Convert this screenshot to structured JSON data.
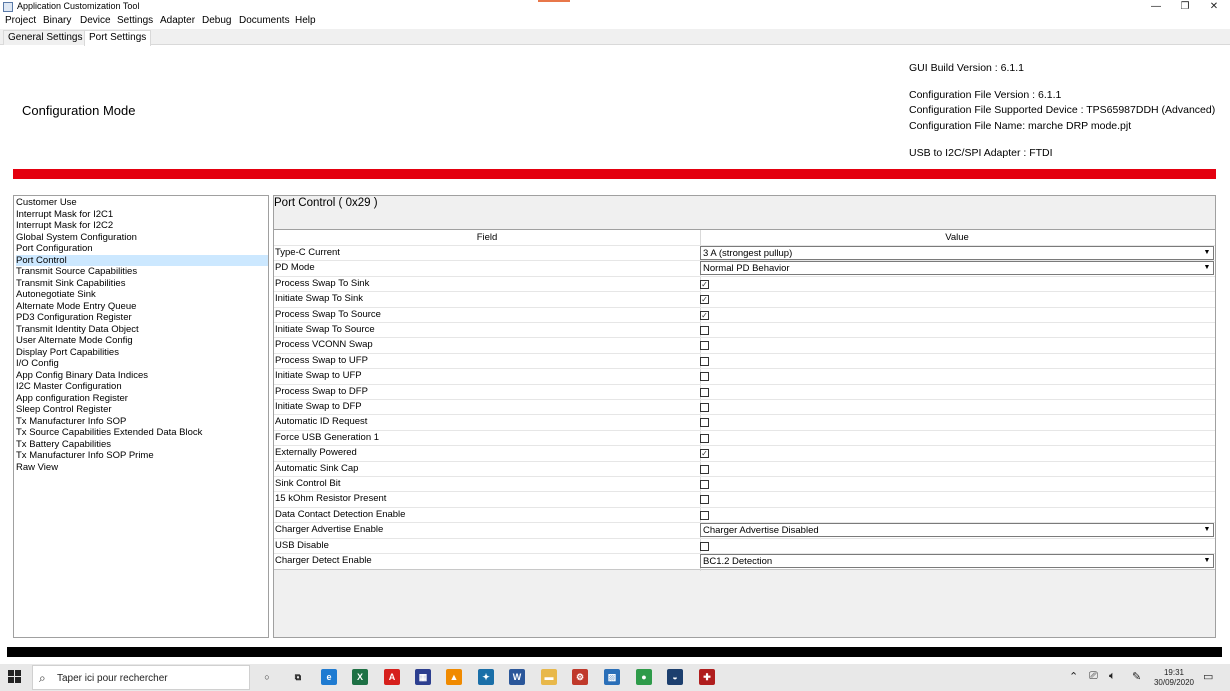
{
  "window": {
    "title": "Application Customization Tool",
    "minimize": "—",
    "restore": "❐",
    "close": "✕"
  },
  "menu": [
    "Project",
    "Binary",
    "Device",
    "Settings",
    "Adapter",
    "Debug",
    "Documents",
    "Help"
  ],
  "tabs": [
    "General Settings",
    "Port Settings"
  ],
  "header": {
    "mode": "Configuration Mode",
    "gui_build": "GUI Build Version : 6.1.1",
    "config_version": "Configuration File Version : 6.1.1",
    "supported_device": "Configuration File Supported Device : TPS65987DDH (Advanced)",
    "file_name": "Configuration File Name: marche DRP mode.pjt",
    "adapter": "USB to I2C/SPI Adapter : FTDI"
  },
  "colors": {
    "red_bar": "#e4000f",
    "selection": "#cce8ff"
  },
  "register_list": [
    "Customer Use",
    "Interrupt Mask for I2C1",
    "Interrupt Mask for I2C2",
    "Global System Configuration",
    "Port Configuration",
    "Port Control",
    "Transmit Source Capabilities",
    "Transmit Sink Capabilities",
    "Autonegotiate Sink",
    "Alternate Mode Entry Queue",
    "PD3 Configuration Register",
    "Transmit Identity Data Object",
    "User Alternate Mode Config",
    "Display Port Capabilities",
    "I/O Config",
    "App Config Binary Data Indices",
    "I2C Master Configuration",
    "App configuration Register",
    "Sleep Control Register",
    "Tx Manufacturer Info SOP",
    "Tx Source Capabilities Extended Data Block",
    "Tx Battery Capabilities",
    "Tx Manufacturer Info SOP Prime",
    "Raw View"
  ],
  "selected_register": "Port Control",
  "panel": {
    "title": "Port Control  ( 0x29 )",
    "col_field": "Field",
    "col_value": "Value",
    "rows": [
      {
        "field": "Type-C Current",
        "type": "dropdown",
        "value": "3 A (strongest pullup)"
      },
      {
        "field": "PD Mode",
        "type": "dropdown",
        "value": "Normal PD Behavior"
      },
      {
        "field": "Process Swap To Sink",
        "type": "checkbox",
        "checked": true
      },
      {
        "field": "Initiate Swap To Sink",
        "type": "checkbox",
        "checked": true
      },
      {
        "field": "Process Swap To Source",
        "type": "checkbox",
        "checked": true
      },
      {
        "field": "Initiate Swap To Source",
        "type": "checkbox",
        "checked": false
      },
      {
        "field": "Process VCONN Swap",
        "type": "checkbox",
        "checked": false
      },
      {
        "field": "Process Swap to UFP",
        "type": "checkbox",
        "checked": false
      },
      {
        "field": "Initiate Swap to UFP",
        "type": "checkbox",
        "checked": false
      },
      {
        "field": "Process Swap to DFP",
        "type": "checkbox",
        "checked": false
      },
      {
        "field": "Initiate Swap to DFP",
        "type": "checkbox",
        "checked": false
      },
      {
        "field": "Automatic ID Request",
        "type": "checkbox",
        "checked": false
      },
      {
        "field": "Force USB Generation 1",
        "type": "checkbox",
        "checked": false
      },
      {
        "field": "Externally Powered",
        "type": "checkbox",
        "checked": true
      },
      {
        "field": "Automatic Sink Cap",
        "type": "checkbox",
        "checked": false
      },
      {
        "field": "Sink Control Bit",
        "type": "checkbox",
        "checked": false
      },
      {
        "field": "15 kOhm Resistor Present",
        "type": "checkbox",
        "checked": false
      },
      {
        "field": "Data Contact Detection Enable",
        "type": "checkbox",
        "checked": false
      },
      {
        "field": "Charger Advertise Enable",
        "type": "dropdown",
        "value": "Charger Advertise Disabled"
      },
      {
        "field": "USB Disable",
        "type": "checkbox",
        "checked": false
      },
      {
        "field": "Charger Detect Enable",
        "type": "dropdown",
        "value": "BC1.2 Detection"
      }
    ]
  },
  "taskbar": {
    "search_placeholder": "Taper ici pour rechercher",
    "time": "19:31",
    "date": "30/09/2020",
    "apps": [
      {
        "name": "cortana-icon",
        "glyph": "○",
        "color": "#e8e8e8"
      },
      {
        "name": "task-view-icon",
        "glyph": "⧉",
        "color": "#e8e8e8"
      },
      {
        "name": "edge-browser-icon",
        "glyph": "e",
        "color": "#1f7bd1"
      },
      {
        "name": "excel-icon",
        "glyph": "X",
        "color": "#1e7145"
      },
      {
        "name": "acrobat-icon",
        "glyph": "A",
        "color": "#d6201c"
      },
      {
        "name": "app-icon-blue",
        "glyph": "▦",
        "color": "#2c3e8f"
      },
      {
        "name": "vlc-icon",
        "glyph": "▲",
        "color": "#f08a00"
      },
      {
        "name": "app-icon-teal",
        "glyph": "✦",
        "color": "#1a6fa8"
      },
      {
        "name": "word-icon",
        "glyph": "W",
        "color": "#2b579a"
      },
      {
        "name": "file-explorer-icon",
        "glyph": "▬",
        "color": "#e8b84a"
      },
      {
        "name": "app-icon-red",
        "glyph": "⚙",
        "color": "#c0392b"
      },
      {
        "name": "photos-icon",
        "glyph": "▨",
        "color": "#2a6fb8"
      },
      {
        "name": "chrome-icon",
        "glyph": "●",
        "color": "#2e9b4a"
      },
      {
        "name": "app-icon-navy",
        "glyph": "◒",
        "color": "#1c3f6e"
      },
      {
        "name": "app-icon-active",
        "glyph": "✚",
        "color": "#b01e1e"
      }
    ],
    "tray_icons": [
      "chevron-up-icon",
      "network-icon",
      "volume-icon",
      "pen-icon"
    ]
  }
}
